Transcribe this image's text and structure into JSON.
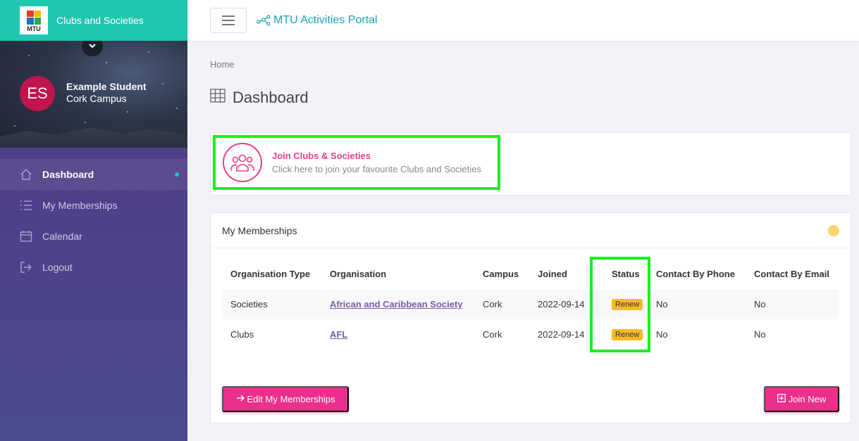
{
  "brand": {
    "logo_text": "MTU",
    "title": "Clubs and Societies"
  },
  "profile": {
    "initials": "ES",
    "name": "Example Student",
    "campus": "Cork Campus"
  },
  "nav": [
    {
      "label": "Dashboard",
      "icon": "home-icon",
      "active": true
    },
    {
      "label": "My Memberships",
      "icon": "list-icon"
    },
    {
      "label": "Calendar",
      "icon": "calendar-icon"
    },
    {
      "label": "Logout",
      "icon": "logout-icon"
    }
  ],
  "topbar": {
    "portal_title": "MTU Activities Portal"
  },
  "breadcrumb": "Home",
  "page_title": "Dashboard",
  "join_card": {
    "title": "Join Clubs & Societies",
    "subtitle": "Click here to join your favourite Clubs and Societies"
  },
  "memberships": {
    "header": "My Memberships",
    "columns": [
      "Organisation Type",
      "Organisation",
      "Campus",
      "Joined",
      "Status",
      "Contact By Phone",
      "Contact By Email"
    ],
    "rows": [
      {
        "type": "Societies",
        "organisation": "African and Caribbean Society",
        "campus": "Cork",
        "joined": "2022-09-14",
        "status": "Renew",
        "phone": "No",
        "email": "No"
      },
      {
        "type": "Clubs",
        "organisation": "AFL",
        "campus": "Cork",
        "joined": "2022-09-14",
        "status": "Renew",
        "phone": "No",
        "email": "No"
      }
    ],
    "edit_button": "Edit My Memberships",
    "join_button": "Join New"
  },
  "colors": {
    "brand": "#1fc6b0",
    "accent": "#ec2f8b",
    "badge": "#f7b924",
    "highlight": "#19f01c"
  }
}
